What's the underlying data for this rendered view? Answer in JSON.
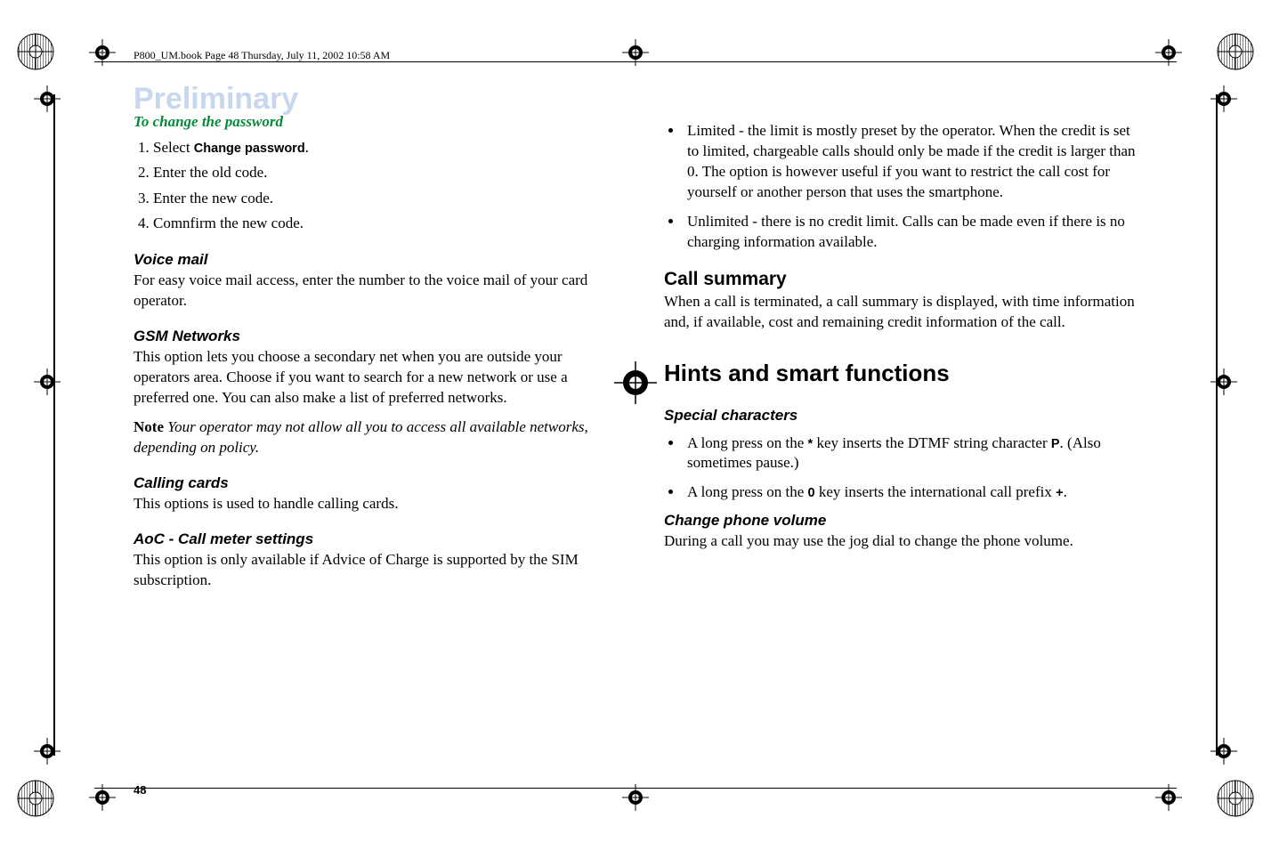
{
  "header": "P800_UM.book  Page 48  Thursday, July 11, 2002  10:58 AM",
  "watermark": "Preliminary",
  "pageNumber": "48",
  "left": {
    "procTitle": "To change the password",
    "steps": {
      "s1a": "Select ",
      "s1b": "Change password",
      "s1c": ".",
      "s2": "Enter the old code.",
      "s3": "Enter the new code.",
      "s4": "Comnfirm the new code."
    },
    "voiceMailH": "Voice mail",
    "voiceMailP": "For easy voice mail access, enter the number to the voice mail of your card operator.",
    "gsmH": "GSM Networks",
    "gsmP": "This option lets you choose a secondary net when you are outside your operators area. Choose if you want to search for a new network or use a preferred one. You can also make a list of preferred networks.",
    "noteLabel": "Note ",
    "noteBody": "Your operator may not allow all you to access all available networks, depending on policy.",
    "cardsH": "Calling cards",
    "cardsP": "This options is used to handle calling cards.",
    "aocH": "AoC - Call meter settings",
    "aocP": "This option is only available if Advice of Charge is supported by the SIM subscription."
  },
  "right": {
    "bul1": "Limited - the limit is mostly preset by the operator. When the credit is set to limited, chargeable calls should only be made if the credit is larger than 0. The option is however useful if you want to restrict the call cost for yourself or another person that uses the smartphone.",
    "bul2": "Unlimited - there is no credit limit. Calls can be made even if there is no charging information available.",
    "callSummaryH": "Call summary",
    "callSummaryP": "When a call is terminated, a call summary is displayed, with time information and, if available, cost and remaining credit information of the call.",
    "hintsH": "Hints and smart functions",
    "specialH": "Special characters",
    "sc1a": "A long press on the ",
    "sc_star": "*",
    "sc1b": " key inserts the DTMF string character ",
    "sc_P": "P",
    "sc1c": ". (Also sometimes pause.)",
    "sc2a": "A long press on the ",
    "sc_zero": "0",
    "sc2b": " key inserts the international call prefix ",
    "sc_plus": "+",
    "sc2c": ".",
    "changeVolH": "Change phone volume",
    "changeVolP": "During a call you may use the jog dial to change the phone volume."
  }
}
